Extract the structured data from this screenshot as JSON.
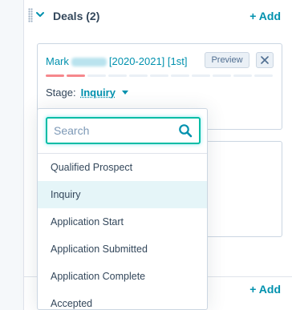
{
  "section": {
    "title": "Deals (2)",
    "add_label": "+ Add"
  },
  "deal_card": {
    "name_first": "Mark",
    "name_suffix": "[2020-2021] [1st]",
    "preview_label": "Preview",
    "close_symbol": "✕",
    "stage_label": "Stage:",
    "stage_value": "Inquiry",
    "stage_progress": {
      "completed": 2,
      "total": 11
    }
  },
  "deal_card_2": {
    "title_fragment": "]"
  },
  "section2": {
    "add_label": "+ Add"
  },
  "stage_dropdown": {
    "search_placeholder": "Search",
    "selected_index": 1,
    "options": [
      "Qualified Prospect",
      "Inquiry",
      "Application Start",
      "Application Submitted",
      "Application Complete",
      "Accepted"
    ]
  },
  "colors": {
    "link": "#0091ae",
    "search_focus": "#00bda5",
    "selected_bg": "#e5f5f8",
    "stage_done": "#f2545b"
  },
  "icons": {
    "expand": "chevron-down-icon",
    "drag": "drag-handle-icon",
    "search": "search-icon",
    "close": "close-icon",
    "stage_caret": "caret-down-icon"
  }
}
